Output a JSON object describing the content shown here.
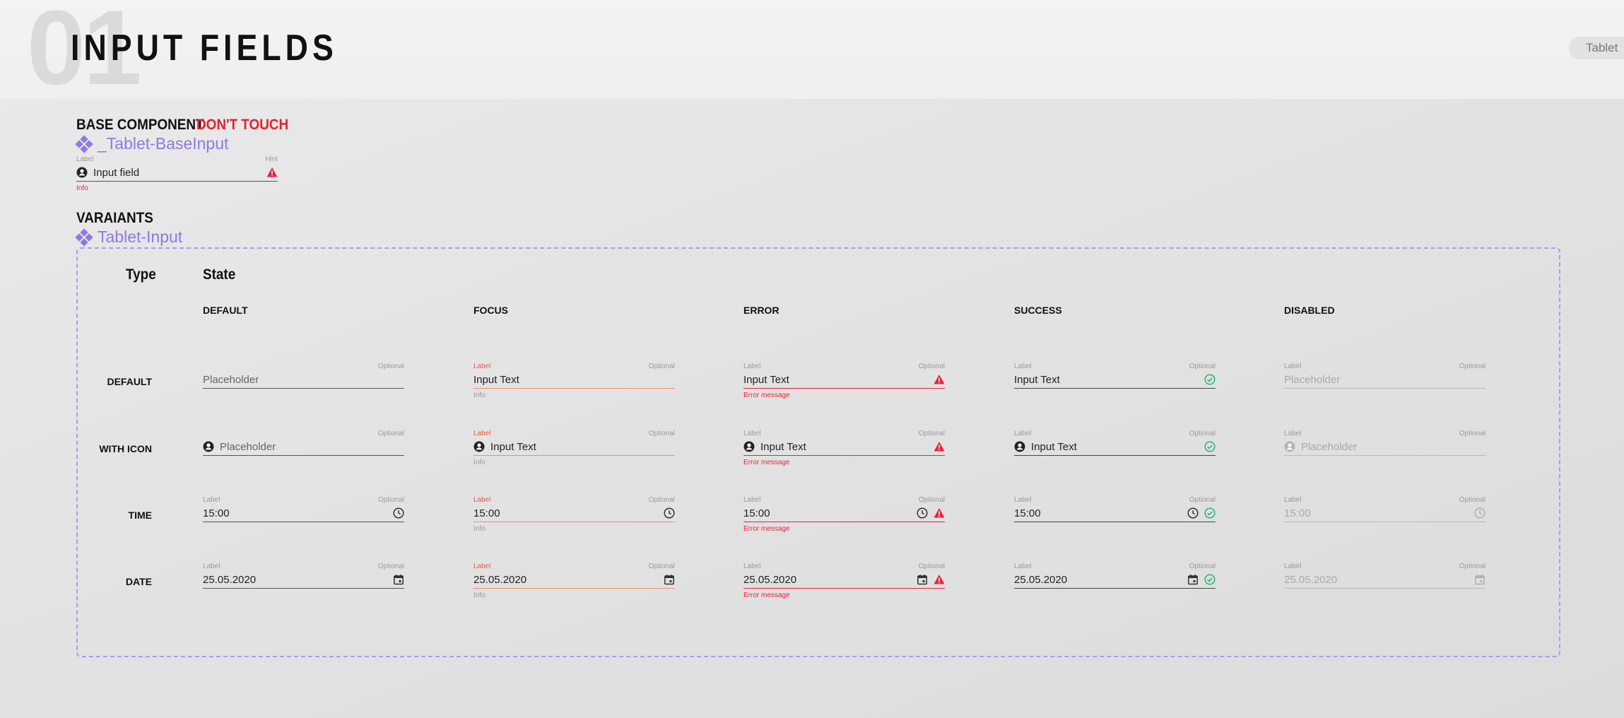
{
  "page": {
    "number": "01",
    "title": "INPUT FIELDS",
    "device_tag": "Tablet"
  },
  "base": {
    "heading": "BASE COMPONENT",
    "warning": "DON'T TOUCH",
    "component_name": "_Tablet-BaseInput",
    "field": {
      "label": "Label",
      "hint": "Hint",
      "value": "Input field",
      "info": "Info"
    }
  },
  "variants": {
    "heading": "VARAIANTS",
    "component_name": "Tablet-Input",
    "type_header": "Type",
    "state_header": "State",
    "columns": [
      "DEFAULT",
      "FOCUS",
      "ERROR",
      "SUCCESS",
      "DISABLED"
    ],
    "rows": [
      "DEFAULT",
      "WITH ICON",
      "TIME",
      "DATE"
    ],
    "labels": {
      "label": "Label",
      "optional": "Optional",
      "info": "Info",
      "error_message": "Error message",
      "placeholder": "Placeholder",
      "input_text": "Input Text",
      "time": "15:00",
      "date": "25.05.2020"
    }
  },
  "colors": {
    "accent_purple": "#8f79e6",
    "error_red": "#e4263b",
    "focus_orange": "#f28a6d",
    "success_green": "#2bb673"
  },
  "icons": [
    "user-icon",
    "warning-icon",
    "clock-icon",
    "calendar-icon",
    "check-circle-icon",
    "component-icon"
  ]
}
